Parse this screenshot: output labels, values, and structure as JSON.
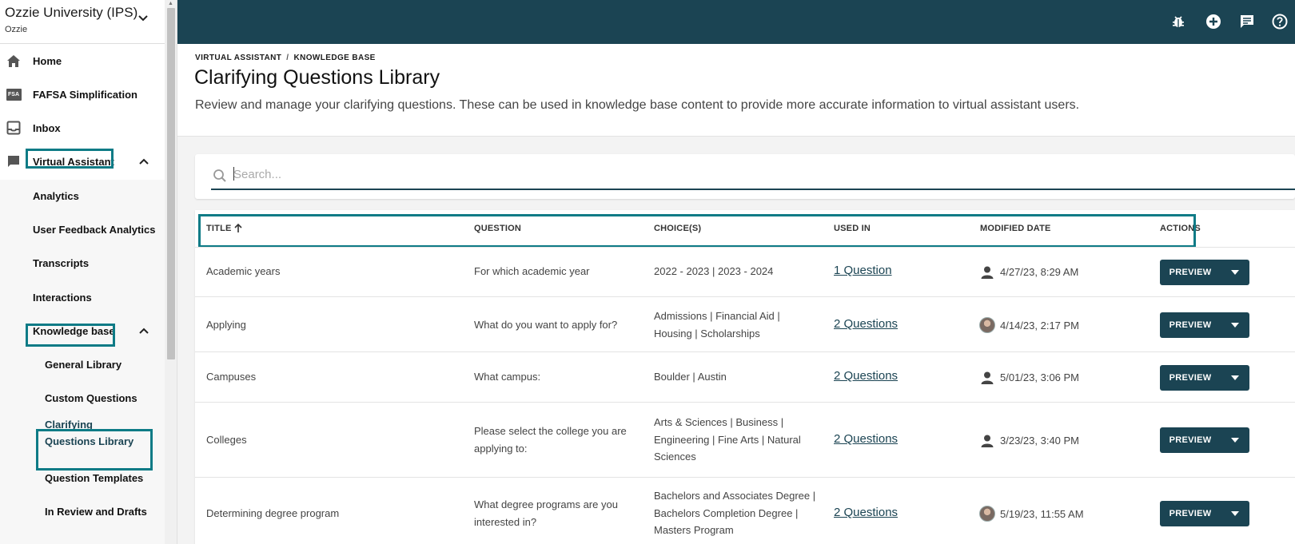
{
  "org": {
    "name": "Ozzie University (IPS)",
    "sub": "Ozzie"
  },
  "sidebar": {
    "items": [
      {
        "label": "Home",
        "icon": "home-icon"
      },
      {
        "label": "FAFSA Simplification",
        "icon": "fsa-icon"
      },
      {
        "label": "Inbox",
        "icon": "inbox-icon"
      },
      {
        "label": "Virtual Assistant",
        "icon": "chat-icon"
      }
    ],
    "va_children": [
      "Analytics",
      "User Feedback Analytics",
      "Transcripts",
      "Interactions",
      "Knowledge base"
    ],
    "kb_children": [
      "General Library",
      "Custom Questions",
      "Clarifying Questions Library",
      "Question Templates",
      "In Review and Drafts"
    ],
    "fsa_badge": "FSA"
  },
  "topbar": {
    "icons": [
      "bug-icon",
      "add-circle-icon",
      "feedback-icon",
      "help-icon"
    ]
  },
  "header": {
    "crumb_1": "VIRTUAL ASSISTANT",
    "crumb_sep": "/",
    "crumb_2": "KNOWLEDGE BASE",
    "title": "Clarifying Questions Library",
    "description": "Review and manage your clarifying questions. These can be used in knowledge base content to provide more accurate information to virtual assistant users."
  },
  "search": {
    "placeholder": "Search...",
    "value": ""
  },
  "table": {
    "columns": [
      "TITLE",
      "QUESTION",
      "CHOICE(S)",
      "USED IN",
      "MODIFIED DATE",
      "ACTIONS"
    ],
    "action_label": "PREVIEW",
    "rows": [
      {
        "title": "Academic years",
        "question": "For which academic year",
        "choices": "2022 - 2023 | 2023 - 2024",
        "used_in": "1 Question",
        "modified": "4/27/23, 8:29 AM",
        "user": "person"
      },
      {
        "title": "Applying",
        "question": "What do you want to apply for?",
        "choices": "Admissions | Financial Aid | Housing | Scholarships",
        "used_in": "2 Questions",
        "modified": "4/14/23, 2:17 PM",
        "user": "photo"
      },
      {
        "title": "Campuses",
        "question": "What campus:",
        "choices": "Boulder | Austin",
        "used_in": "2 Questions",
        "modified": "5/01/23, 3:06 PM",
        "user": "person"
      },
      {
        "title": "Colleges",
        "question": "Please select the college you are applying to:",
        "choices": "Arts & Sciences | Business | Engineering | Fine Arts | Natural Sciences",
        "used_in": "2 Questions",
        "modified": "3/23/23, 3:40 PM",
        "user": "person"
      },
      {
        "title": "Determining degree program",
        "question": "What degree programs are you interested in?",
        "choices": "Bachelors and Associates Degree | Bachelors Completion Degree | Masters Program",
        "used_in": "2 Questions",
        "modified": "5/19/23, 11:55 AM",
        "user": "photo"
      }
    ]
  },
  "colors": {
    "primary": "#1b4453",
    "highlight": "#0e7b86"
  }
}
